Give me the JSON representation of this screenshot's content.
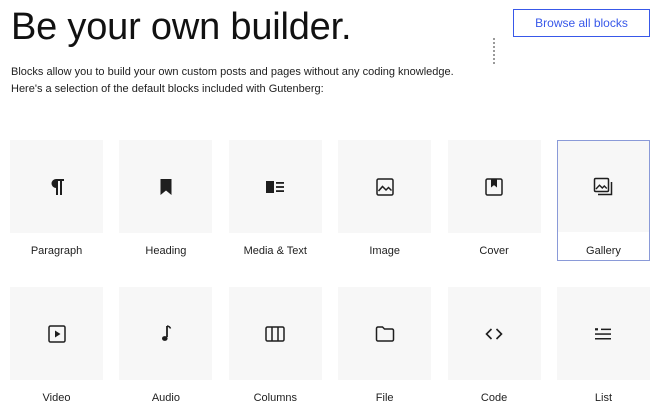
{
  "header": {
    "title": "Be your own builder.",
    "browse_label": "Browse all blocks"
  },
  "intro": {
    "line1": "Blocks allow you to build your own custom posts and pages without any coding knowledge.",
    "line2": "Here's a selection of the default blocks included with Gutenberg:"
  },
  "blocks": [
    {
      "label": "Paragraph",
      "icon": "paragraph-icon"
    },
    {
      "label": "Heading",
      "icon": "bookmark-icon"
    },
    {
      "label": "Media & Text",
      "icon": "media-text-icon"
    },
    {
      "label": "Image",
      "icon": "image-icon"
    },
    {
      "label": "Cover",
      "icon": "cover-icon"
    },
    {
      "label": "Gallery",
      "icon": "gallery-icon",
      "selected": true
    },
    {
      "label": "Video",
      "icon": "video-icon"
    },
    {
      "label": "Audio",
      "icon": "audio-note-icon"
    },
    {
      "label": "Columns",
      "icon": "columns-icon"
    },
    {
      "label": "File",
      "icon": "folder-icon"
    },
    {
      "label": "Code",
      "icon": "code-icon"
    },
    {
      "label": "List",
      "icon": "list-icon"
    }
  ],
  "colors": {
    "accent": "#3858e9",
    "tile_bg": "#f7f7f7",
    "selected_border": "#8a9ad8"
  }
}
